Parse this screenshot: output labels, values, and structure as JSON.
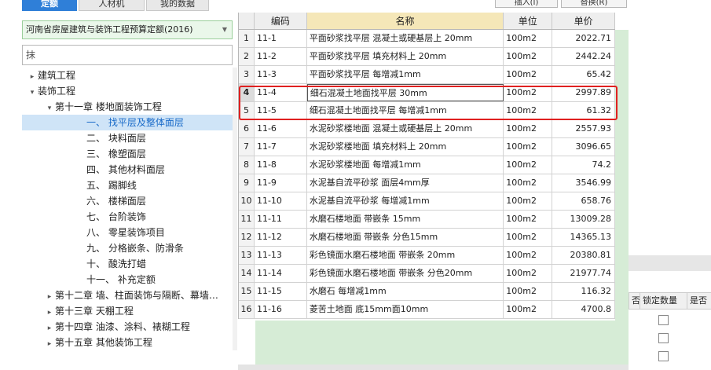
{
  "tabs": [
    "定额",
    "人材机",
    "我的数据"
  ],
  "quota_select": "河南省房屋建筑与装饰工程预算定额(2016)",
  "search_value": "抹",
  "top_buttons": [
    "插入(I)",
    "替换(R)"
  ],
  "tree": [
    {
      "label": "建筑工程",
      "level": 0,
      "arrow": "▸"
    },
    {
      "label": "装饰工程",
      "level": 0,
      "arrow": "▾"
    },
    {
      "label": "第十一章 楼地面装饰工程",
      "level": 1,
      "arrow": "▾"
    },
    {
      "label": "一、 找平层及整体面层",
      "level": 2,
      "arrow": "",
      "selected": true
    },
    {
      "label": "二、 块料面层",
      "level": 2,
      "arrow": ""
    },
    {
      "label": "三、 橡塑面层",
      "level": 2,
      "arrow": ""
    },
    {
      "label": "四、 其他材料面层",
      "level": 2,
      "arrow": ""
    },
    {
      "label": "五、 踢脚线",
      "level": 2,
      "arrow": ""
    },
    {
      "label": "六、 楼梯面层",
      "level": 2,
      "arrow": ""
    },
    {
      "label": "七、 台阶装饰",
      "level": 2,
      "arrow": ""
    },
    {
      "label": "八、 零星装饰项目",
      "level": 2,
      "arrow": ""
    },
    {
      "label": "九、 分格嵌条、防滑条",
      "level": 2,
      "arrow": ""
    },
    {
      "label": "十、 酸洗打蜡",
      "level": 2,
      "arrow": ""
    },
    {
      "label": "十一、 补充定额",
      "level": 2,
      "arrow": ""
    },
    {
      "label": "第十二章 墙、柱面装饰与隔断、幕墙…",
      "level": 1,
      "arrow": "▸"
    },
    {
      "label": "第十三章 天棚工程",
      "level": 1,
      "arrow": "▸"
    },
    {
      "label": "第十四章 油漆、涂料、裱糊工程",
      "level": 1,
      "arrow": "▸"
    },
    {
      "label": "第十五章 其他装饰工程",
      "level": 1,
      "arrow": "▸"
    }
  ],
  "grid": {
    "headers": [
      "",
      "编码",
      "名称",
      "单位",
      "单价"
    ],
    "rows": [
      {
        "idx": "1",
        "code": "11-1",
        "name": "平面砂浆找平层 混凝土或硬基层上 20mm",
        "unit": "100m2",
        "price": "2022.71"
      },
      {
        "idx": "2",
        "code": "11-2",
        "name": "平面砂浆找平层 填充材料上 20mm",
        "unit": "100m2",
        "price": "2442.24"
      },
      {
        "idx": "3",
        "code": "11-3",
        "name": "平面砂浆找平层 每增减1mm",
        "unit": "100m2",
        "price": "65.42"
      },
      {
        "idx": "4",
        "code": "11-4",
        "name": "细石混凝土地面找平层 30mm",
        "unit": "100m2",
        "price": "2997.89",
        "active": true
      },
      {
        "idx": "5",
        "code": "11-5",
        "name": "细石混凝土地面找平层 每增减1mm",
        "unit": "100m2",
        "price": "61.32"
      },
      {
        "idx": "6",
        "code": "11-6",
        "name": "水泥砂浆楼地面 混凝土或硬基层上 20mm",
        "unit": "100m2",
        "price": "2557.93"
      },
      {
        "idx": "7",
        "code": "11-7",
        "name": "水泥砂浆楼地面 填充材料上 20mm",
        "unit": "100m2",
        "price": "3096.65"
      },
      {
        "idx": "8",
        "code": "11-8",
        "name": "水泥砂浆楼地面 每增减1mm",
        "unit": "100m2",
        "price": "74.2"
      },
      {
        "idx": "9",
        "code": "11-9",
        "name": "水泥基自流平砂浆 面层4mm厚",
        "unit": "100m2",
        "price": "3546.99"
      },
      {
        "idx": "10",
        "code": "11-10",
        "name": "水泥基自流平砂浆 每增减1mm",
        "unit": "100m2",
        "price": "658.76"
      },
      {
        "idx": "11",
        "code": "11-11",
        "name": "水磨石楼地面 带嵌条 15mm",
        "unit": "100m2",
        "price": "13009.28"
      },
      {
        "idx": "12",
        "code": "11-12",
        "name": "水磨石楼地面 带嵌条 分色15mm",
        "unit": "100m2",
        "price": "14365.13"
      },
      {
        "idx": "13",
        "code": "11-13",
        "name": "彩色镜面水磨石楼地面 带嵌条 20mm",
        "unit": "100m2",
        "price": "20380.81"
      },
      {
        "idx": "14",
        "code": "11-14",
        "name": "彩色镜面水磨石楼地面 带嵌条 分色20mm",
        "unit": "100m2",
        "price": "21977.74"
      },
      {
        "idx": "15",
        "code": "11-15",
        "name": "水磨石 每增减1mm",
        "unit": "100m2",
        "price": "116.32"
      },
      {
        "idx": "16",
        "code": "11-16",
        "name": "菱苦土地面 底15mm面10mm",
        "unit": "100m2",
        "price": "4700.8"
      }
    ]
  },
  "background_panel": {
    "headers": [
      "否",
      "锁定数量",
      "是否"
    ],
    "left_fragment": "价"
  }
}
